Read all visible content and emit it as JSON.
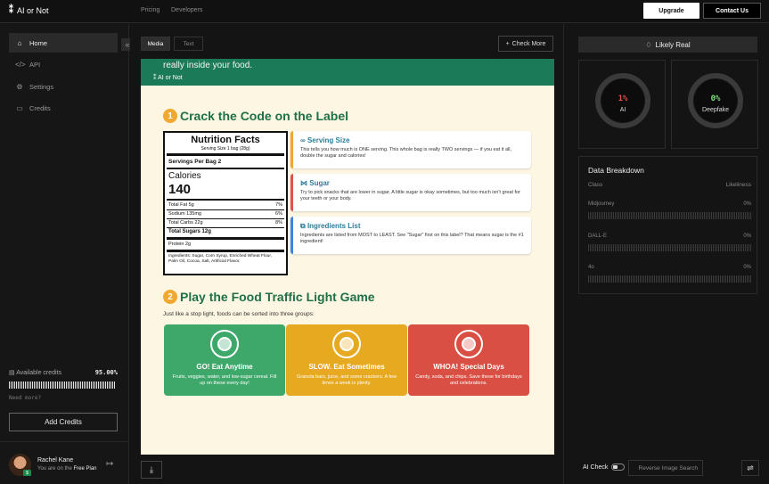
{
  "header": {
    "brand": "AI or Not",
    "nav": [
      "Pricing",
      "Developers"
    ],
    "upgrade": "Upgrade",
    "contact": "Contact Us"
  },
  "sidebar": {
    "items": [
      {
        "label": "Home",
        "icon": "home-icon"
      },
      {
        "label": "API",
        "icon": "code-icon"
      },
      {
        "label": "Settings",
        "icon": "gear-icon"
      },
      {
        "label": "Credits",
        "icon": "card-icon"
      }
    ],
    "credits_label": "Available credits",
    "credits_value": "95.00%",
    "credits_fraction": 0.95,
    "need_more": "Need more?",
    "add_credits": "Add Credits",
    "user_name": "Rachel Kane",
    "user_plan_prefix": "You are on the ",
    "user_plan": "Free Plan"
  },
  "main": {
    "tabs": [
      "Media",
      "Text"
    ],
    "check_more": "Check More",
    "preview": {
      "banner_text": "really inside your food.",
      "banner_logo": "AI or Not",
      "section1_num": "1",
      "section1_title": "Crack the Code on the Label",
      "label": {
        "title": "Nutrition Facts",
        "serving_size": "Serving Size 1 bag (28g)",
        "servings": "Servings Per Bag   2",
        "calories_label": "Calories",
        "calories": "140",
        "rows": [
          {
            "name": "Total Fat 5g",
            "pct": "7%"
          },
          {
            "name": "Sodium 135mg",
            "pct": "6%"
          },
          {
            "name": "Total Carbs 22g",
            "pct": "8%"
          }
        ],
        "sugars": "Total Sugars 12g",
        "protein": "Protein 2g",
        "ingredients": "Ingredients: Sugar, Corn Syrup, Enriched Wheat Flour, Palm Oil, Cocoa, Salt, Artificial Flavor."
      },
      "tips": [
        {
          "title": "Serving Size",
          "body": "This tells you how much is ONE serving. This whole bag is really TWO servings — if you eat it all, double the sugar and calories!",
          "color": "#f0a830"
        },
        {
          "title": "Sugar",
          "body": "Try to pick snacks that are lower in sugar. A little sugar is okay sometimes, but too much isn't great for your teeth or your body.",
          "color": "#e0524a"
        },
        {
          "title": "Ingredients List",
          "body": "Ingredients are listed from MOST to LEAST. See \"Sugar\" first on this label? That means sugar is the #1 ingredient!",
          "color": "#3a86e0"
        }
      ],
      "section2_num": "2",
      "section2_title": "Play the Food Traffic Light Game",
      "intro": "Just like a stop light, foods can be sorted into three groups:",
      "cards": [
        {
          "title": "GO! Eat Anytime",
          "body": "Fruits, veggies, water, and low-sugar cereal. Fill up on these every day!",
          "color": "#3da86a"
        },
        {
          "title": "SLOW. Eat Sometimes",
          "body": "Granola bars, juice, and some crackers. A few times a week is plenty.",
          "color": "#e6a91f"
        },
        {
          "title": "WHOA! Special Days",
          "body": "Candy, soda, and chips. Save these for birthdays and celebrations.",
          "color": "#d94f43"
        }
      ]
    }
  },
  "results": {
    "verdict": "Likely Real",
    "ai_value": "1%",
    "ai_label": "AI",
    "deepfake_value": "0%",
    "deepfake_label": "Deepfake",
    "ai_color": "#e0524a",
    "deepfake_color": "#7ee081",
    "breakdown_title": "Data Breakdown",
    "col_class": "Class",
    "col_likeliness": "Likeliness",
    "rows": [
      {
        "name": "Midjourney",
        "value": "0%"
      },
      {
        "name": "DALL-E",
        "value": "0%"
      },
      {
        "name": "4o",
        "value": "0%"
      }
    ],
    "ai_check": "AI Check",
    "reverse_search": "Reverse Image Search"
  }
}
